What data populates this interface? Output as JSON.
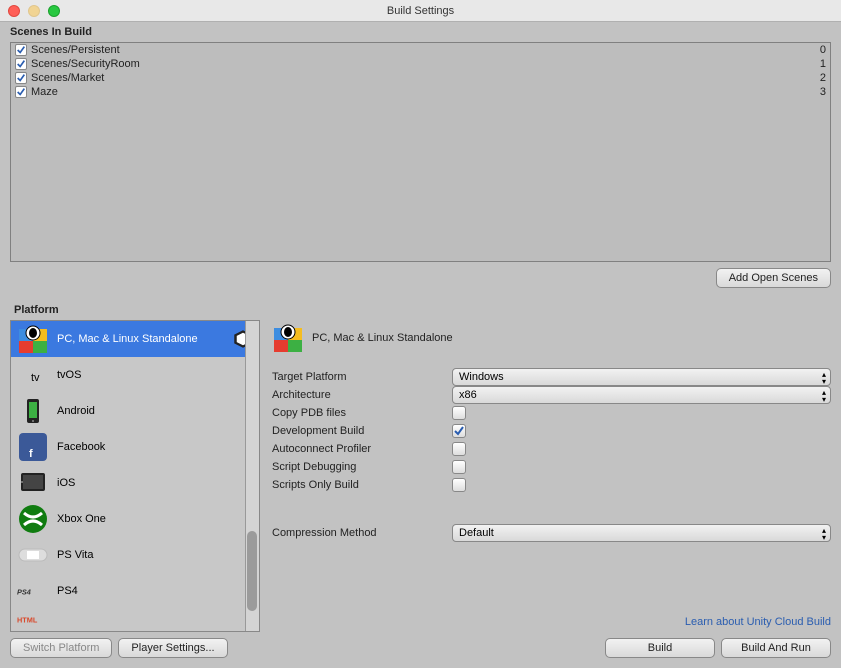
{
  "window_title": "Build Settings",
  "labels": {
    "scenes_in_build": "Scenes In Build",
    "add_open_scenes": "Add Open Scenes",
    "platform_header": "Platform",
    "switch_platform": "Switch Platform",
    "player_settings": "Player Settings...",
    "build": "Build",
    "build_and_run": "Build And Run",
    "learn_link": "Learn about Unity Cloud Build"
  },
  "scenes": [
    {
      "name": "Scenes/Persistent",
      "index": "0",
      "checked": true
    },
    {
      "name": "Scenes/SecurityRoom",
      "index": "1",
      "checked": true
    },
    {
      "name": "Scenes/Market",
      "index": "2",
      "checked": true
    },
    {
      "name": "Maze",
      "index": "3",
      "checked": true
    }
  ],
  "platforms": {
    "selected": "PC, Mac & Linux Standalone",
    "items": [
      {
        "icon": "pcmaclinux",
        "label": "PC, Mac & Linux Standalone"
      },
      {
        "icon": "tvos",
        "label": "tvOS"
      },
      {
        "icon": "android",
        "label": "Android"
      },
      {
        "icon": "facebook",
        "label": "Facebook"
      },
      {
        "icon": "ios",
        "label": "iOS"
      },
      {
        "icon": "xboxone",
        "label": "Xbox One"
      },
      {
        "icon": "psvita",
        "label": "PS Vita"
      },
      {
        "icon": "ps4",
        "label": "PS4"
      },
      {
        "icon": "html5",
        "label": ""
      }
    ]
  },
  "details": {
    "title": "PC, Mac & Linux Standalone",
    "target_platform": {
      "label": "Target Platform",
      "value": "Windows"
    },
    "architecture": {
      "label": "Architecture",
      "value": "x86"
    },
    "copy_pdb": {
      "label": "Copy PDB files",
      "checked": false
    },
    "dev_build": {
      "label": "Development Build",
      "checked": true
    },
    "autoconnect": {
      "label": "Autoconnect Profiler",
      "checked": false
    },
    "script_debug": {
      "label": "Script Debugging",
      "checked": false
    },
    "scripts_only": {
      "label": "Scripts Only Build",
      "checked": false
    },
    "compression": {
      "label": "Compression Method",
      "value": "Default"
    }
  }
}
